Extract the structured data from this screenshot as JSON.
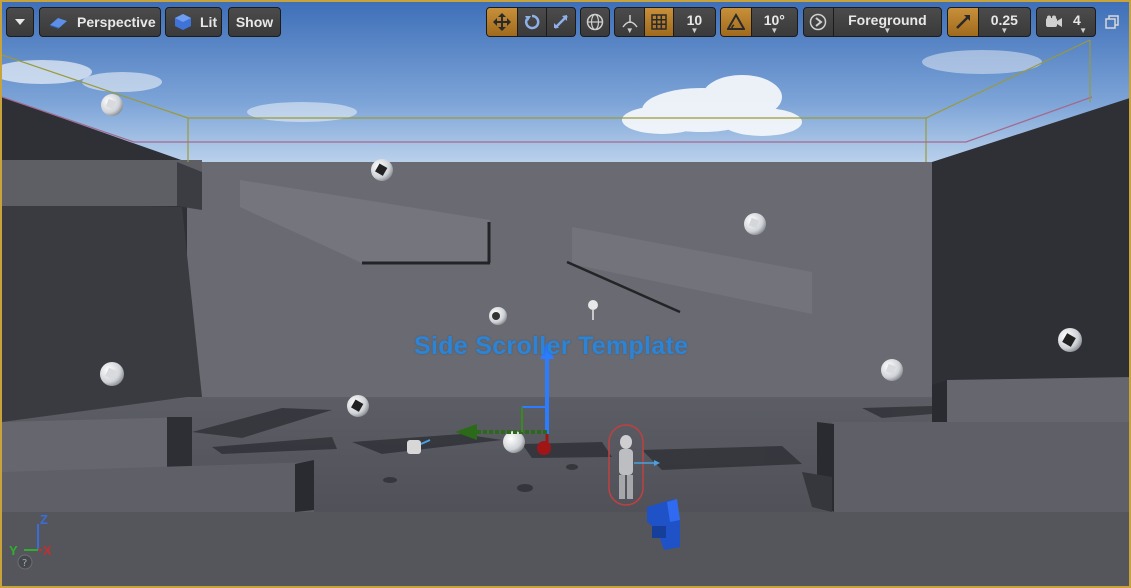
{
  "viewport_toolbar": {
    "options_menu_icon": "chevron-down-icon",
    "view_mode": "Perspective",
    "lighting_mode": "Lit",
    "show_label": "Show",
    "grid_snap_value": "10",
    "rotation_snap_value": "10°",
    "layer_label": "Foreground",
    "scale_snap_value": "0.25",
    "camera_speed_value": "4"
  },
  "scene": {
    "template_title": "Side Scroller Template"
  },
  "axis_gizmo": {
    "z_label": "Z",
    "y_label": "Y",
    "x_label": "X"
  },
  "colors": {
    "accent_active": "#c8903a",
    "viewport_border": "#c8a23a",
    "title_text": "#2c84d6"
  }
}
